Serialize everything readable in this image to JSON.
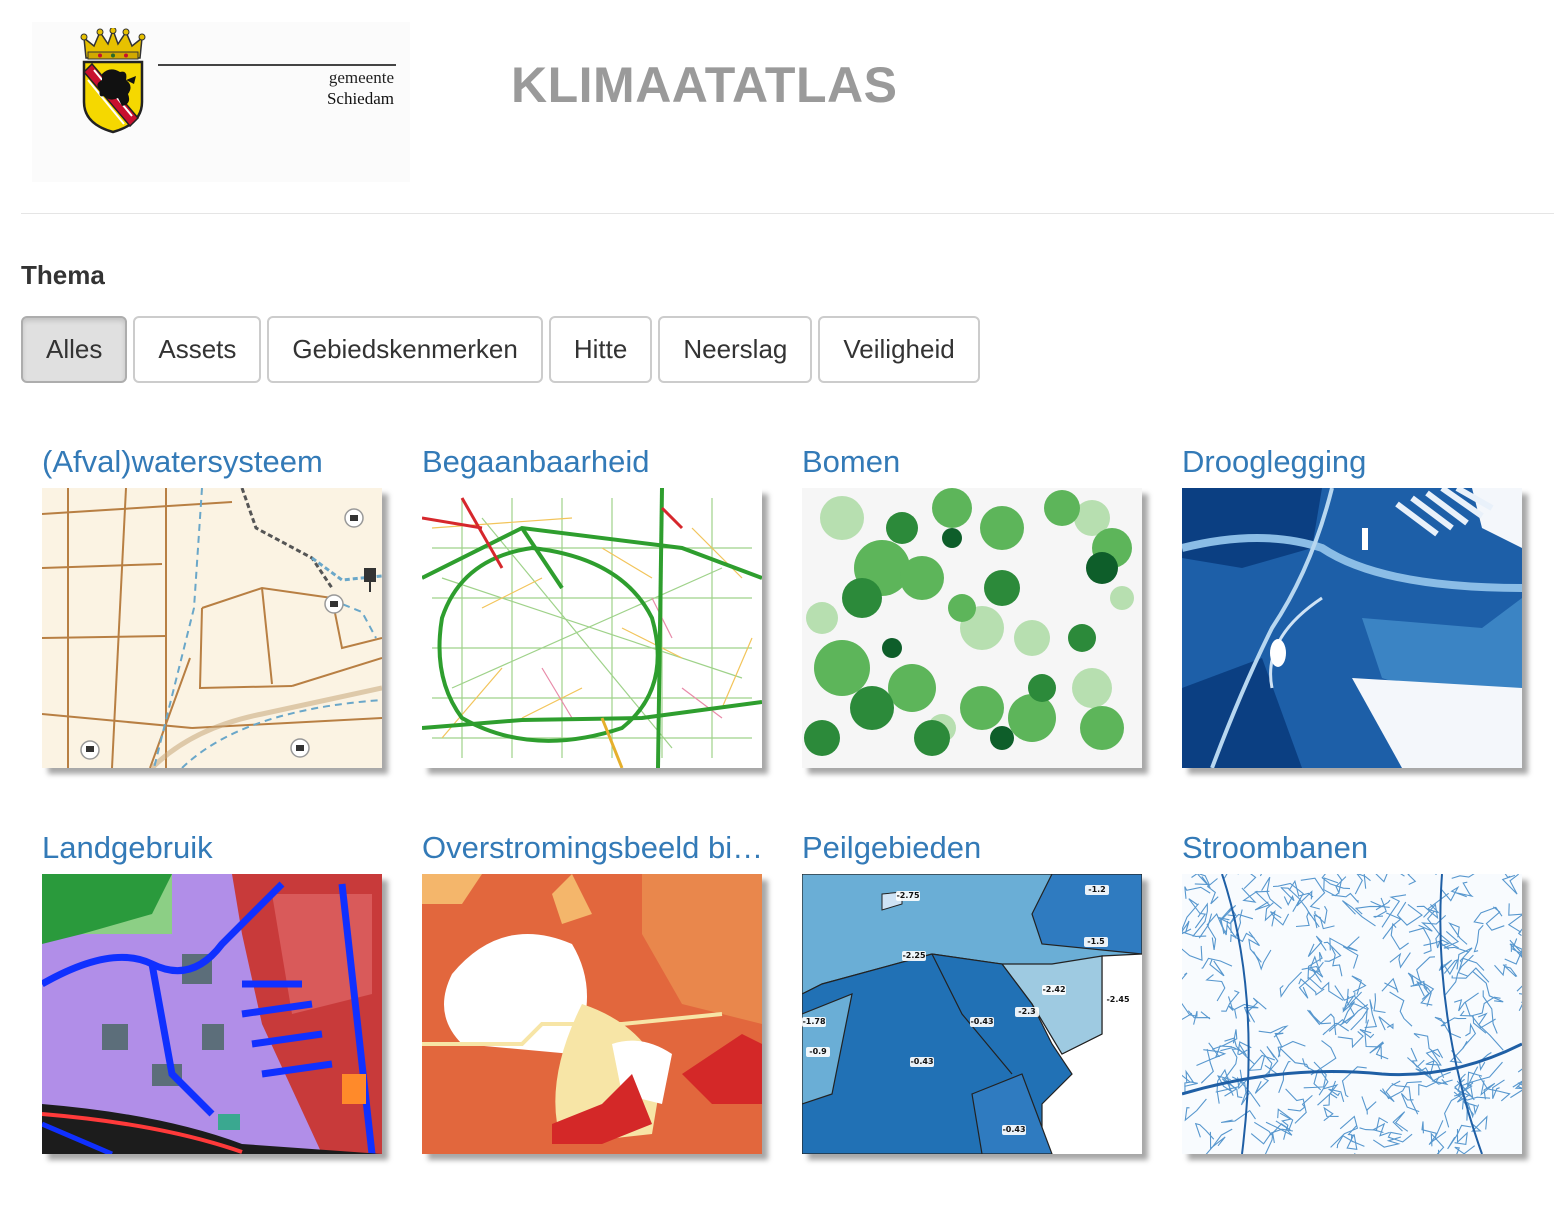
{
  "header": {
    "logo_line1": "gemeente",
    "logo_line2": "Schiedam",
    "title": "KLIMAATATLAS"
  },
  "filter": {
    "label": "Thema",
    "active": "Alles",
    "options": [
      "Alles",
      "Assets",
      "Gebiedskenmerken",
      "Hitte",
      "Neerslag",
      "Veiligheid"
    ]
  },
  "maps": [
    {
      "title": "(Afval)watersysteem"
    },
    {
      "title": "Begaanbaarheid"
    },
    {
      "title": "Bomen"
    },
    {
      "title": "Drooglegging"
    },
    {
      "title": "Landgebruik"
    },
    {
      "title": "Overstromingsbeeld bij dijkdoorbraak"
    },
    {
      "title": "Peilgebieden",
      "labels": [
        "-2.75",
        "-1.2",
        "-1.5",
        "-2.25",
        "-2.42",
        "-2.45",
        "-2.3",
        "-0.43",
        "-1.78",
        "-0.9",
        "-0.43",
        "-0.43"
      ]
    },
    {
      "title": "Stroombanen"
    }
  ],
  "colors": {
    "title_gray": "#9a9a9a",
    "link_blue": "#337ab7",
    "crest_yellow": "#f5d800",
    "crest_red": "#c8102e"
  }
}
